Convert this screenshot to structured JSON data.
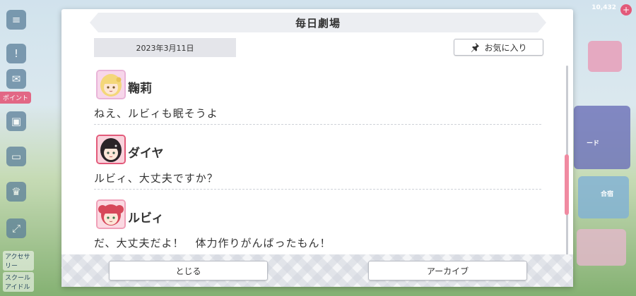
{
  "background": {
    "left_rail": {
      "event_tag": "ポイント",
      "labels": [
        "アクセサリー",
        "スクール\nアイドル"
      ]
    },
    "right_panel": {
      "currency": "10,432",
      "badge": "+",
      "tiles": [
        "ード",
        "合宿"
      ]
    }
  },
  "dialog": {
    "title": "毎日劇場",
    "date": "2023年3月11日",
    "favorite_label": "お気に入り",
    "entries": [
      {
        "speaker": "鞠莉",
        "line": "ねえ、ルビィも眠そうよ",
        "frame_color": "#e9b4d8"
      },
      {
        "speaker": "ダイヤ",
        "line": "ルビィ、大丈夫ですか？",
        "frame_color": "#e35a7a"
      },
      {
        "speaker": "ルビィ",
        "line": "だ、大丈夫だよ！　体力作りがんばったもん！",
        "frame_color": "#f0a0b8"
      }
    ],
    "close_label": "とじる",
    "archive_label": "アーカイブ"
  },
  "colors": {
    "accent": "#f08aa1",
    "title_bar": "#eceef2"
  }
}
